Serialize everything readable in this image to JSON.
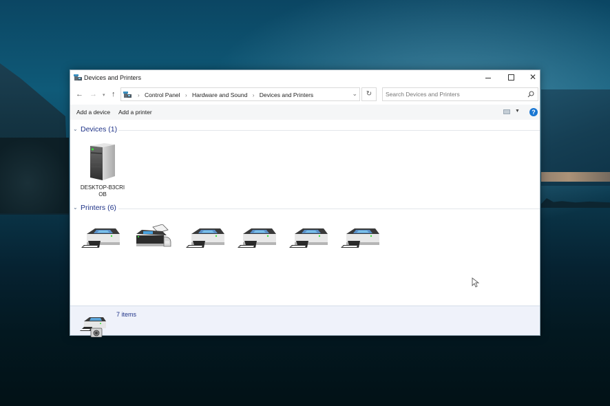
{
  "window": {
    "title": "Devices and Printers",
    "controls": {
      "minimize": "—",
      "maximize": "☐",
      "close": "✕"
    }
  },
  "navigation": {
    "back_icon": "←",
    "forward_icon": "→",
    "recent_icon": "▾",
    "up_icon": "↑",
    "breadcrumbs": [
      "Control Panel",
      "Hardware and Sound",
      "Devices and Printers"
    ],
    "separator": "›",
    "dropdown_icon": "⌄",
    "refresh_icon": "↻",
    "search_placeholder": "Search Devices and Printers",
    "search_value": ""
  },
  "commands": {
    "add_device": "Add a device",
    "add_printer": "Add a printer",
    "help": "?"
  },
  "groups": {
    "devices": {
      "chevron": "⌄",
      "label": "Devices (1)",
      "items": [
        {
          "name": "DESKTOP-B3CRIOB",
          "label_line1": "DESKTOP-B3CRI",
          "label_line2": "OB",
          "icon": "computer-tower-icon"
        }
      ]
    },
    "printers": {
      "chevron": "⌄",
      "label": "Printers (6)",
      "items": [
        {
          "icon": "printer-icon"
        },
        {
          "icon": "fax-icon"
        },
        {
          "icon": "printer-icon"
        },
        {
          "icon": "printer-icon"
        },
        {
          "icon": "printer-icon"
        },
        {
          "icon": "printer-icon"
        }
      ]
    }
  },
  "details": {
    "item_count": "7 items",
    "icon": "printer-camera-icon"
  },
  "colors": {
    "group_header": "#1e3287",
    "help": "#1976d2",
    "details_bg": "#eff2fa",
    "command_bar_bg": "#f5f6f7"
  }
}
